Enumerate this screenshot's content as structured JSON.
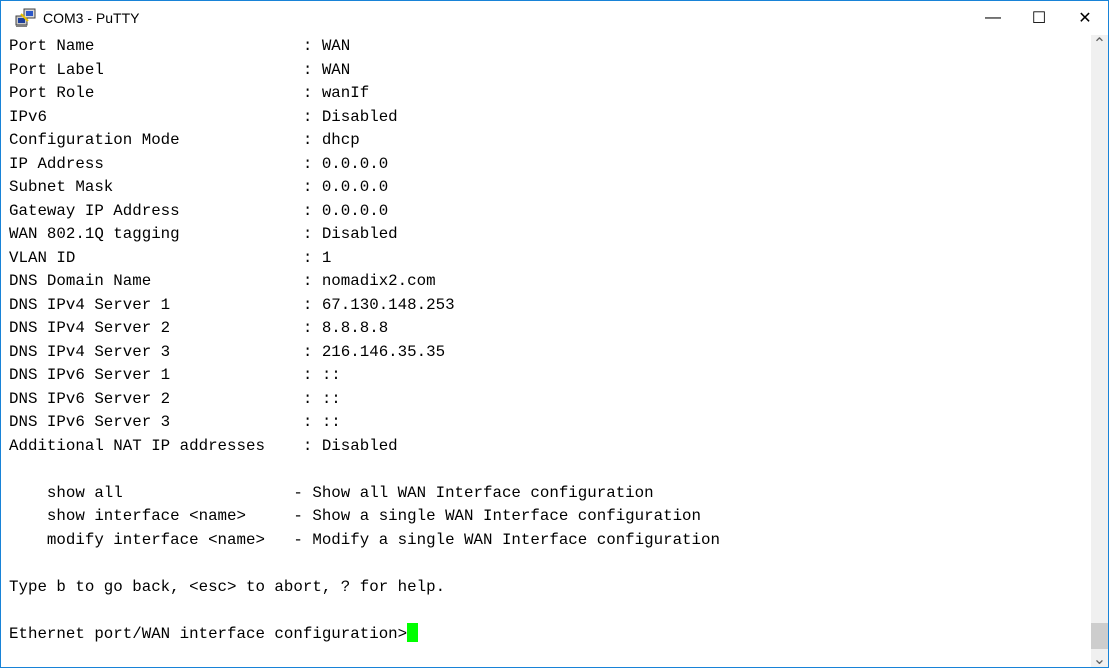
{
  "window": {
    "title": "COM3 - PuTTY",
    "icons": {
      "app": "putty-computers-icon",
      "minimize": "minimize-icon",
      "maximize": "maximize-icon",
      "close": "close-icon"
    },
    "minimize_glyph": "—",
    "maximize_glyph": "☐",
    "close_glyph": "✕"
  },
  "terminal": {
    "lines": [
      "Port Name                      : WAN",
      "Port Label                     : WAN",
      "Port Role                      : wanIf",
      "IPv6                           : Disabled",
      "Configuration Mode             : dhcp",
      "IP Address                     : 0.0.0.0",
      "Subnet Mask                    : 0.0.0.0",
      "Gateway IP Address             : 0.0.0.0",
      "WAN 802.1Q tagging             : Disabled",
      "VLAN ID                        : 1",
      "DNS Domain Name                : nomadix2.com",
      "DNS IPv4 Server 1              : 67.130.148.253",
      "DNS IPv4 Server 2              : 8.8.8.8",
      "DNS IPv4 Server 3              : 216.146.35.35",
      "DNS IPv6 Server 1              : ::",
      "DNS IPv6 Server 2              : ::",
      "DNS IPv6 Server 3              : ::",
      "Additional NAT IP addresses    : Disabled",
      "",
      "    show all                  - Show all WAN Interface configuration",
      "    show interface <name>     - Show a single WAN Interface configuration",
      "    modify interface <name>   - Modify a single WAN Interface configuration",
      "",
      "Type b to go back, <esc> to abort, ? for help.",
      ""
    ],
    "prompt": "Ethernet port/WAN interface configuration>",
    "cursor_color": "#00ff00"
  },
  "scrollbar": {
    "up_glyph": "⌃",
    "down_glyph": "⌄"
  }
}
